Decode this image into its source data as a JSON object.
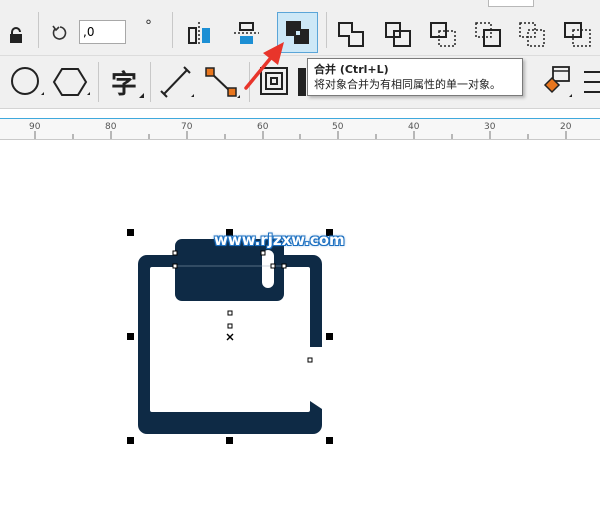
{
  "toolbar": {
    "rotation_value": ",0",
    "degree_symbol": "°",
    "combine_tooltip": {
      "title": "合并 (Ctrl+L)",
      "description": "将对象合并为有相同属性的单一对象。"
    },
    "text_tool_glyph": "字",
    "property_buttons": [
      "lock-icon",
      "rotate-icon",
      "angle-input",
      "mirror-horizontal-icon",
      "mirror-vertical-icon",
      "combine-icon",
      "weld-icon",
      "trim-icon",
      "intersect-icon",
      "simplify-icon",
      "front-minus-back-icon",
      "back-minus-front-icon"
    ],
    "tool_buttons": [
      "ellipse-tool-icon",
      "polygon-tool-icon",
      "text-tool-icon",
      "line-tool-icon",
      "connector-tool-icon",
      "contour-tool-icon",
      "fill-tool-icon"
    ]
  },
  "ruler": {
    "labels": [
      "90",
      "80",
      "70",
      "60",
      "50",
      "40",
      "30",
      "20"
    ]
  },
  "canvas": {
    "watermark": "www.rjzxw.com",
    "shape_color": "#0e2a45"
  },
  "colors": {
    "accent": "#3fa9dd",
    "arrow": "#e8352b",
    "handle": "#000000"
  }
}
